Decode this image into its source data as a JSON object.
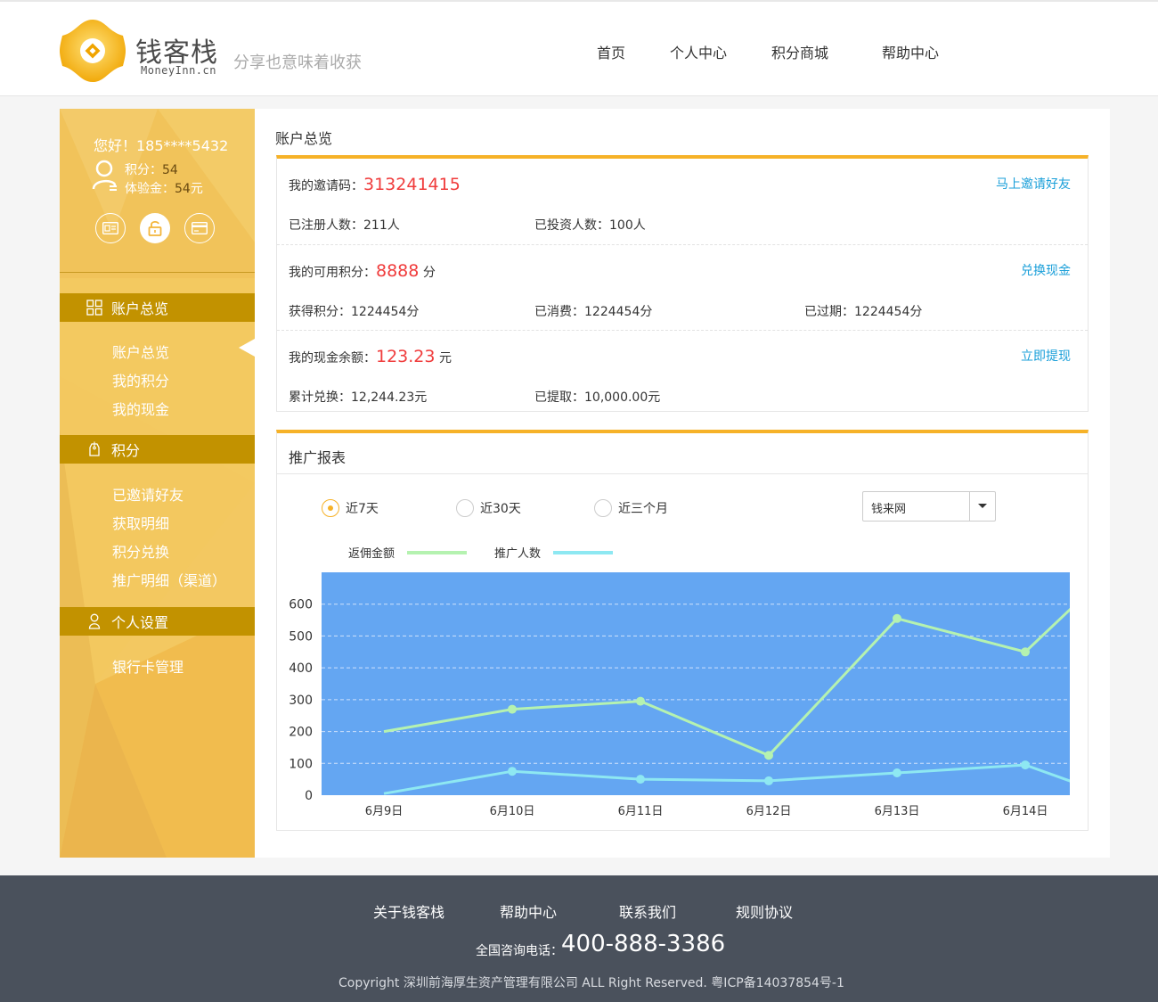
{
  "brand": {
    "name": "钱客栈",
    "domain": "MoneyInn.cn",
    "slogan": "分享也意味着收获",
    "color_primary": "#f6b228",
    "color_sidebar": "#f3c85f",
    "color_section": "#c29200"
  },
  "nav": [
    "首页",
    "个人中心",
    "积分商城",
    "帮助中心"
  ],
  "sidebar": {
    "greeting": "您好！185****5432",
    "points_label": "积分：",
    "points_value": "54",
    "trial_label": "体验金：",
    "trial_value": "54",
    "trial_unit": "元",
    "sections": [
      {
        "title": "账户总览",
        "icon": "grid-icon",
        "items": [
          "账户总览",
          "我的积分",
          "我的现金"
        ]
      },
      {
        "title": "积分",
        "icon": "tag-icon",
        "items": [
          "已邀请好友",
          "获取明细",
          "积分兑换",
          "推广明细（渠道）"
        ]
      },
      {
        "title": "个人设置",
        "icon": "person-icon",
        "items": [
          "银行卡管理"
        ]
      }
    ]
  },
  "overview": {
    "title": "账户总览",
    "invite": {
      "label": "我的邀请码：",
      "value": "313241415",
      "link": "马上邀请好友",
      "registered": "已注册人数：211人",
      "invested": "已投资人数：100人"
    },
    "points": {
      "label": "我的可用积分：",
      "value": "8888",
      "unit": "分",
      "link": "兑换现金",
      "earned": "获得积分：1224454分",
      "spent": "已消费：1224454分",
      "expired": "已过期：1224454分"
    },
    "cash": {
      "label": "我的现金余额：",
      "value": "123.23",
      "unit": "元",
      "link": "立即提现",
      "exchanged": "累计兑换：12,244.23元",
      "withdrawn": "已提取：10,000.00元"
    }
  },
  "report": {
    "title": "推广报表",
    "ranges": [
      "近7天",
      "近30天",
      "近三个月"
    ],
    "selected_range": "近7天",
    "source_select": "钱来网"
  },
  "chart_data": {
    "type": "line",
    "categories": [
      "6月9日",
      "6月10日",
      "6月11日",
      "6月12日",
      "6月13日",
      "6月14日"
    ],
    "x": [
      9,
      10,
      11,
      12,
      13,
      14,
      14.38
    ],
    "series": [
      {
        "name": "返佣金额",
        "color": "#b5f2b0",
        "values": [
          200,
          270,
          295,
          125,
          555,
          450,
          595
        ],
        "markers": [
          false,
          true,
          true,
          true,
          true,
          true,
          false
        ]
      },
      {
        "name": "推广人数",
        "color": "#8ee8f2",
        "values": [
          5,
          75,
          50,
          45,
          70,
          95,
          40
        ],
        "markers": [
          false,
          true,
          true,
          true,
          true,
          true,
          false
        ]
      }
    ],
    "yticks": [
      0,
      100,
      200,
      300,
      400,
      500,
      600
    ],
    "ylim": [
      0,
      700
    ],
    "plot_background": "#64a6f2",
    "grid": true
  },
  "footer": {
    "links": [
      "关于钱客栈",
      "帮助中心",
      "联系我们",
      "规则协议"
    ],
    "phone_label": "全国咨询电话：",
    "phone": "400-888-3386",
    "copyright": "Copyright   深圳前海厚生资产管理有限公司  ALL Right Reserved. 粤ICP备14037854号-1"
  }
}
